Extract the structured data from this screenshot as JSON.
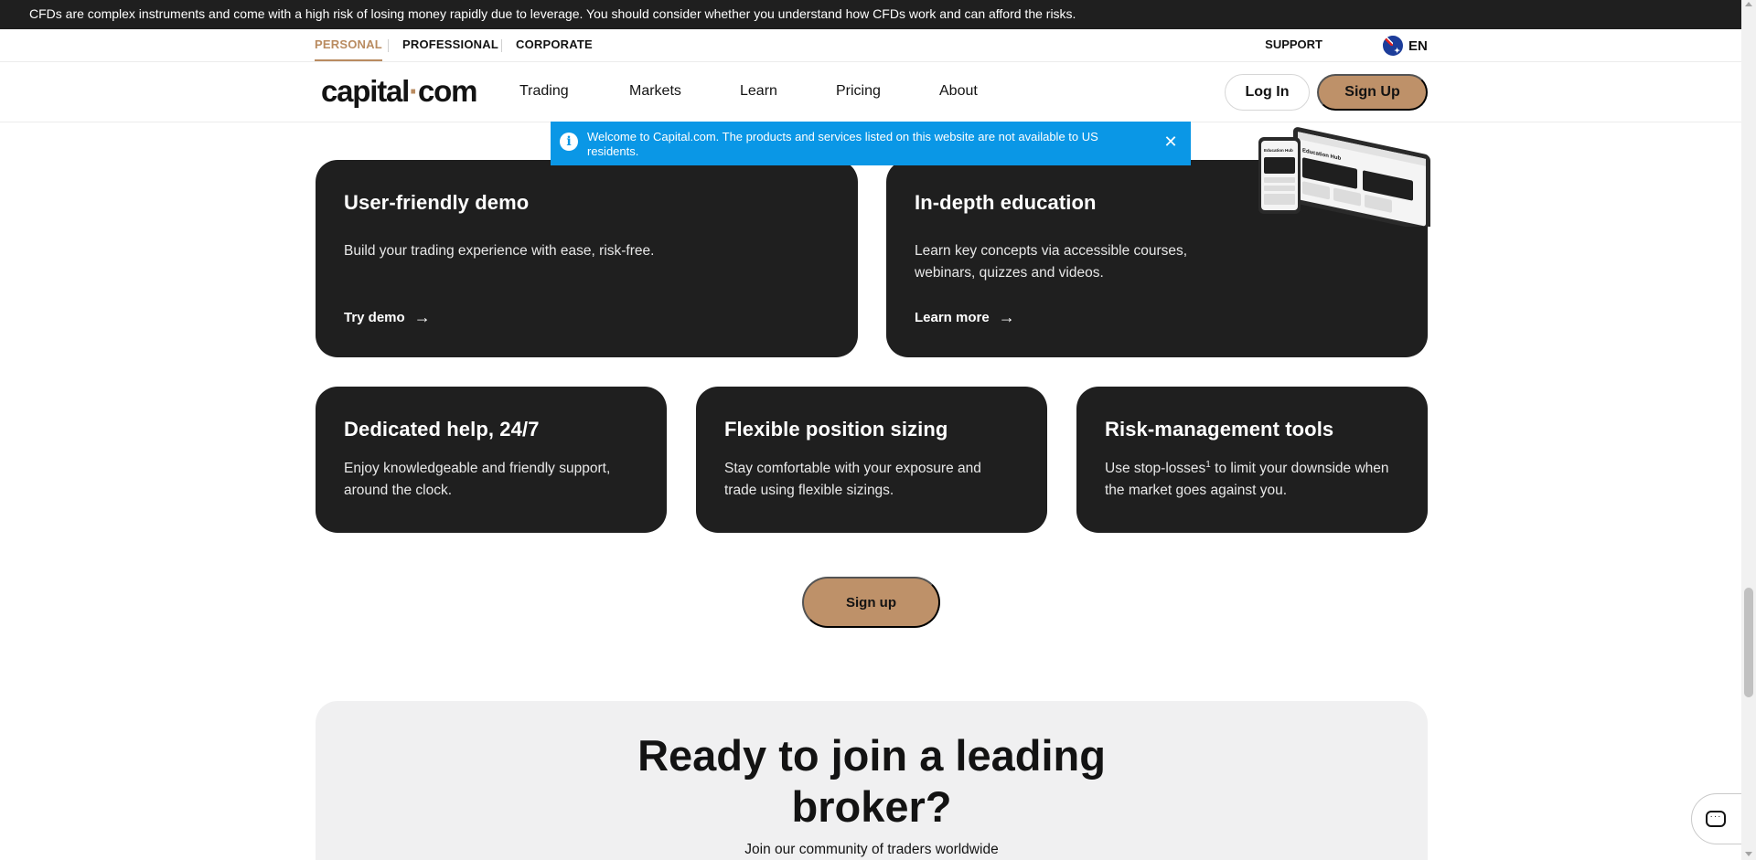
{
  "risk_warning": "CFDs are complex instruments and come with a high risk of losing money rapidly due to leverage. You should consider whether you understand how CFDs work and can afford the risks.",
  "segments": [
    "PERSONAL",
    "PROFESSIONAL",
    "CORPORATE"
  ],
  "support": "SUPPORT",
  "language": "EN",
  "logo": {
    "part1": "capital",
    "dot": "·",
    "part2": "com"
  },
  "nav": [
    "Trading",
    "Markets",
    "Learn",
    "Pricing",
    "About"
  ],
  "auth": {
    "login": "Log In",
    "signup": "Sign Up"
  },
  "notice": {
    "text": "Welcome to Capital.com. The products and services listed on this website are not available to US residents.",
    "icon": "i",
    "close": "✕"
  },
  "cards": {
    "demo": {
      "title": "User-friendly demo",
      "text": "Build your trading experience with ease, risk-free.",
      "link": "Try demo"
    },
    "education": {
      "title": "In-depth education",
      "text": "Learn key concepts via accessible courses, webinars, quizzes and videos.",
      "link": "Learn more"
    },
    "help": {
      "title": "Dedicated help, 24/7",
      "text": "Enjoy knowledgeable and friendly support, around the clock."
    },
    "sizing": {
      "title": "Flexible position sizing",
      "text": "Stay comfortable with your exposure and trade using flexible sizings."
    },
    "risk": {
      "title": "Risk-management tools",
      "text_before": "Use stop-losses",
      "sup": "1",
      "text_after": " to limit your downside when the market goes against you."
    }
  },
  "arrow": "→",
  "cta_signup": "Sign up",
  "join": {
    "title_line1": "Ready to join a leading",
    "title_line2": "broker?",
    "subtitle": "Join our community of traders worldwide"
  },
  "device_screen": {
    "tablet_heading": "Education Hub",
    "phone_heading": "Education Hub"
  },
  "colors": {
    "accent": "#be9169",
    "card": "#1f1f1f",
    "notice": "#0a97e6"
  }
}
